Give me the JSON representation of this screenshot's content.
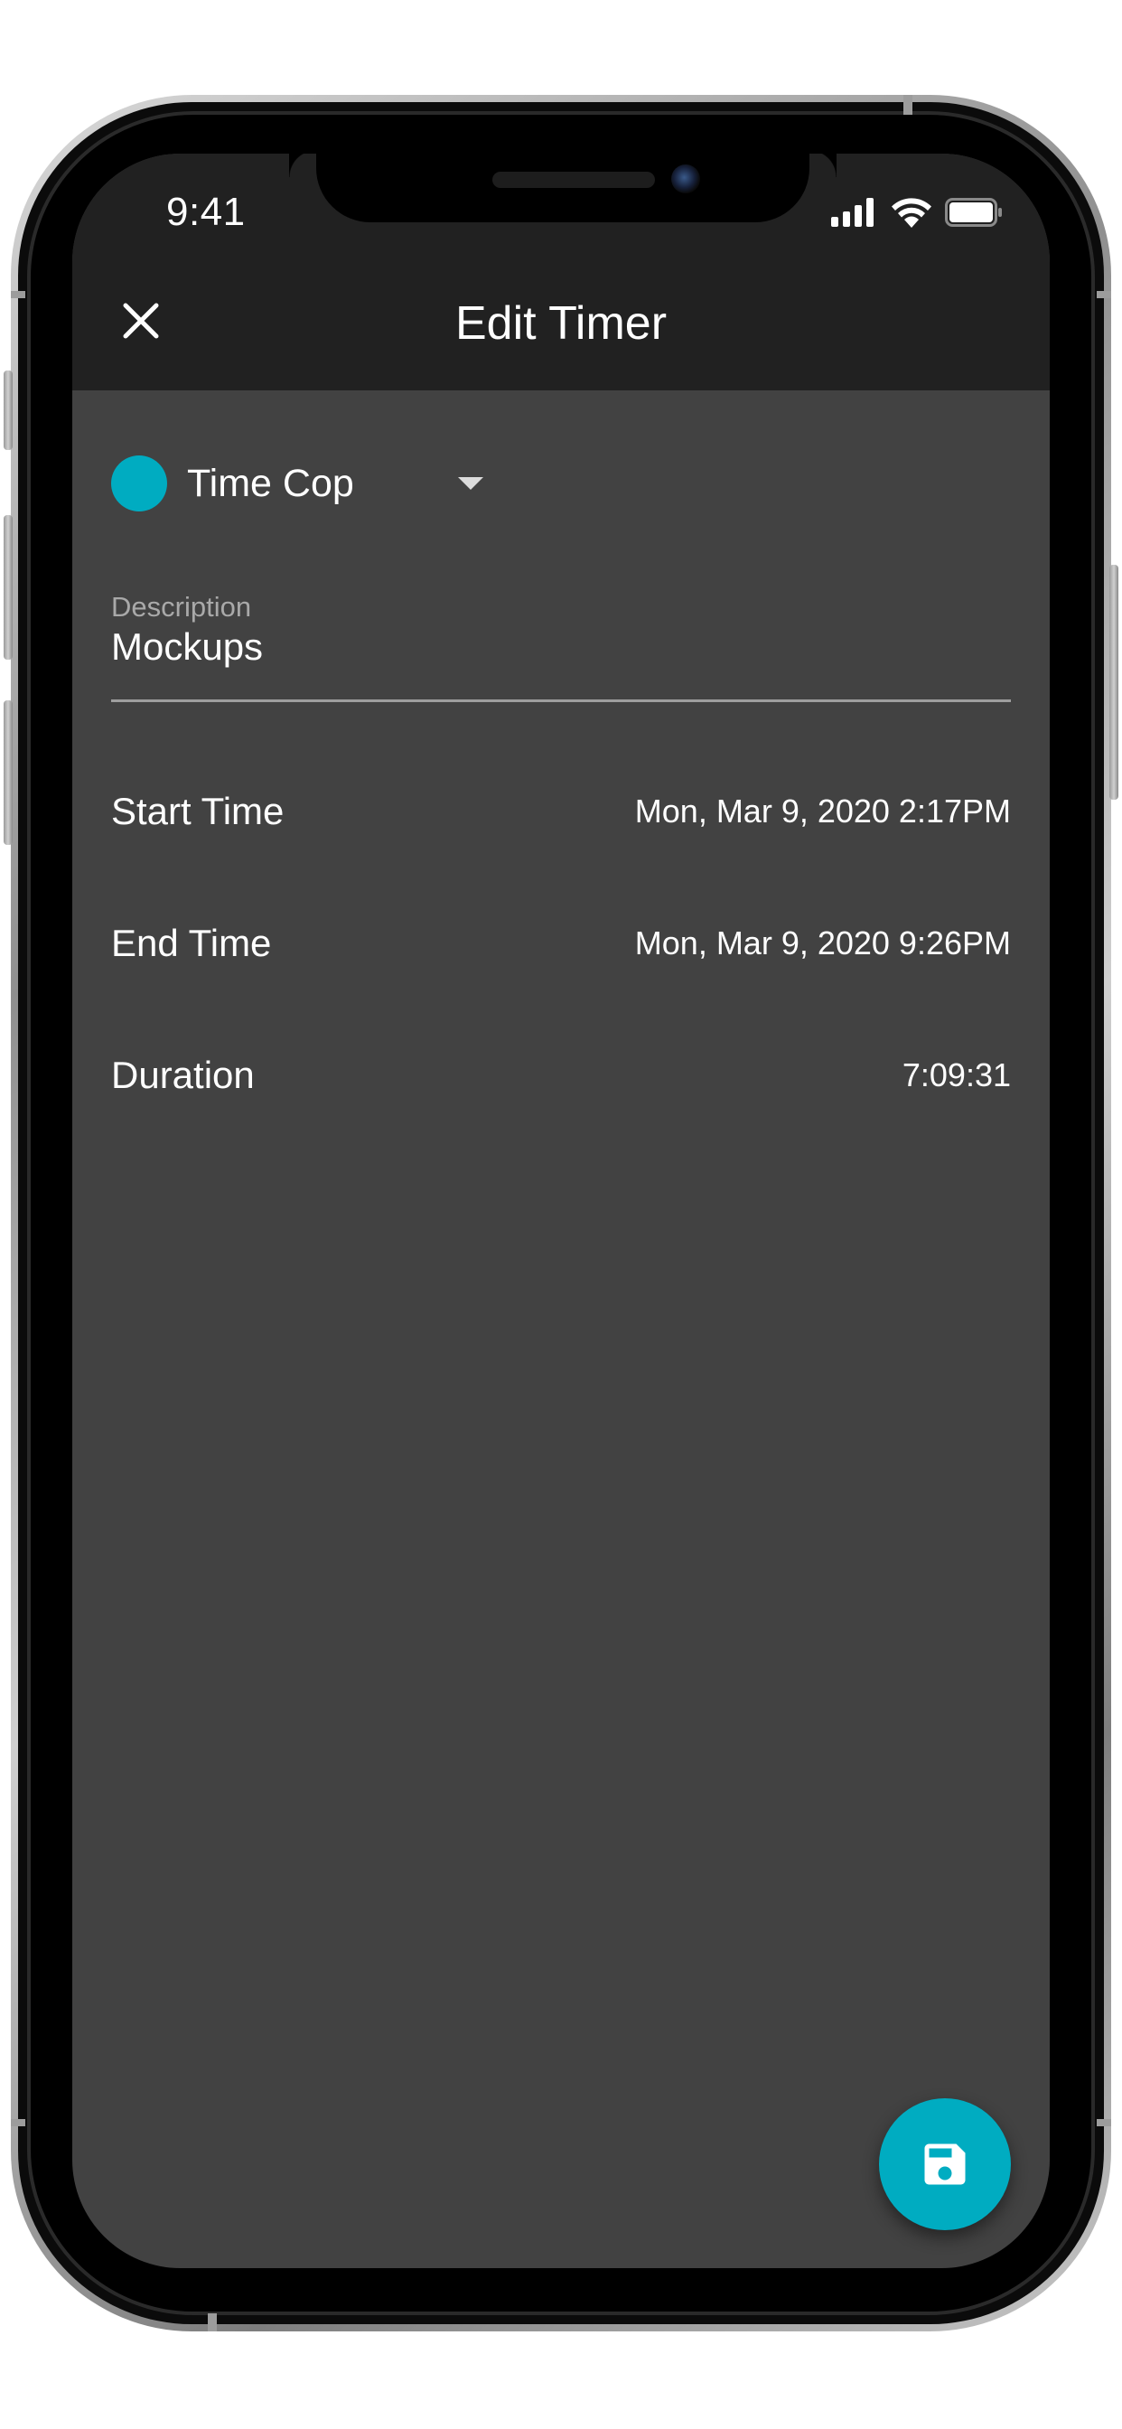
{
  "status_bar": {
    "time": "9:41"
  },
  "header": {
    "title": "Edit Timer",
    "close_icon": "close-icon"
  },
  "project": {
    "name": "Time Cop",
    "color": "#00acc1"
  },
  "description": {
    "label": "Description",
    "value": "Mockups"
  },
  "fields": [
    {
      "label": "Start Time",
      "value": "Mon, Mar 9, 2020 2:17PM"
    },
    {
      "label": "End Time",
      "value": "Mon, Mar 9, 2020 9:26PM"
    },
    {
      "label": "Duration",
      "value": "7:09:31"
    }
  ],
  "fab": {
    "icon": "save-icon",
    "color": "#00acc1"
  },
  "colors": {
    "accent": "#00acc1",
    "app_bar": "#212121",
    "background": "#424242"
  }
}
